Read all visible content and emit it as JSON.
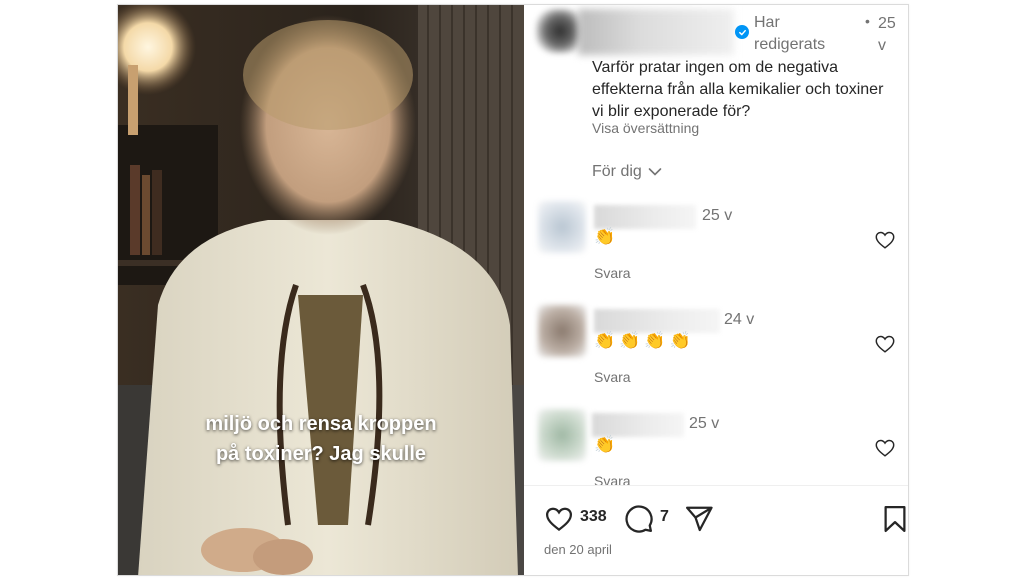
{
  "post": {
    "caption_overlay_lines": [
      "miljö och rensa kroppen",
      "på toxiner? Jag skulle"
    ],
    "header": {
      "edited_label": "Har redigerats",
      "dot": "•",
      "time": "25 v"
    },
    "text": "Varför pratar ingen om de negativa effekterna från alla kemikalier och toxiner vi blir exponerade för?",
    "translate_label": "Visa översättning",
    "sort_label": "För dig",
    "comments": [
      {
        "time": "25 v",
        "emoji": "👏",
        "reply_label": "Svara"
      },
      {
        "time": "24 v",
        "emoji": "👏👏👏👏",
        "reply_label": "Svara"
      },
      {
        "time": "25 v",
        "emoji": "👏",
        "reply_label": "Svara"
      }
    ],
    "actions": {
      "likes": "338",
      "comments": "7"
    },
    "date": "den 20 april"
  },
  "colors": {
    "verified": "#0095f6",
    "secondary_text": "#737373",
    "primary_text": "#262626"
  }
}
